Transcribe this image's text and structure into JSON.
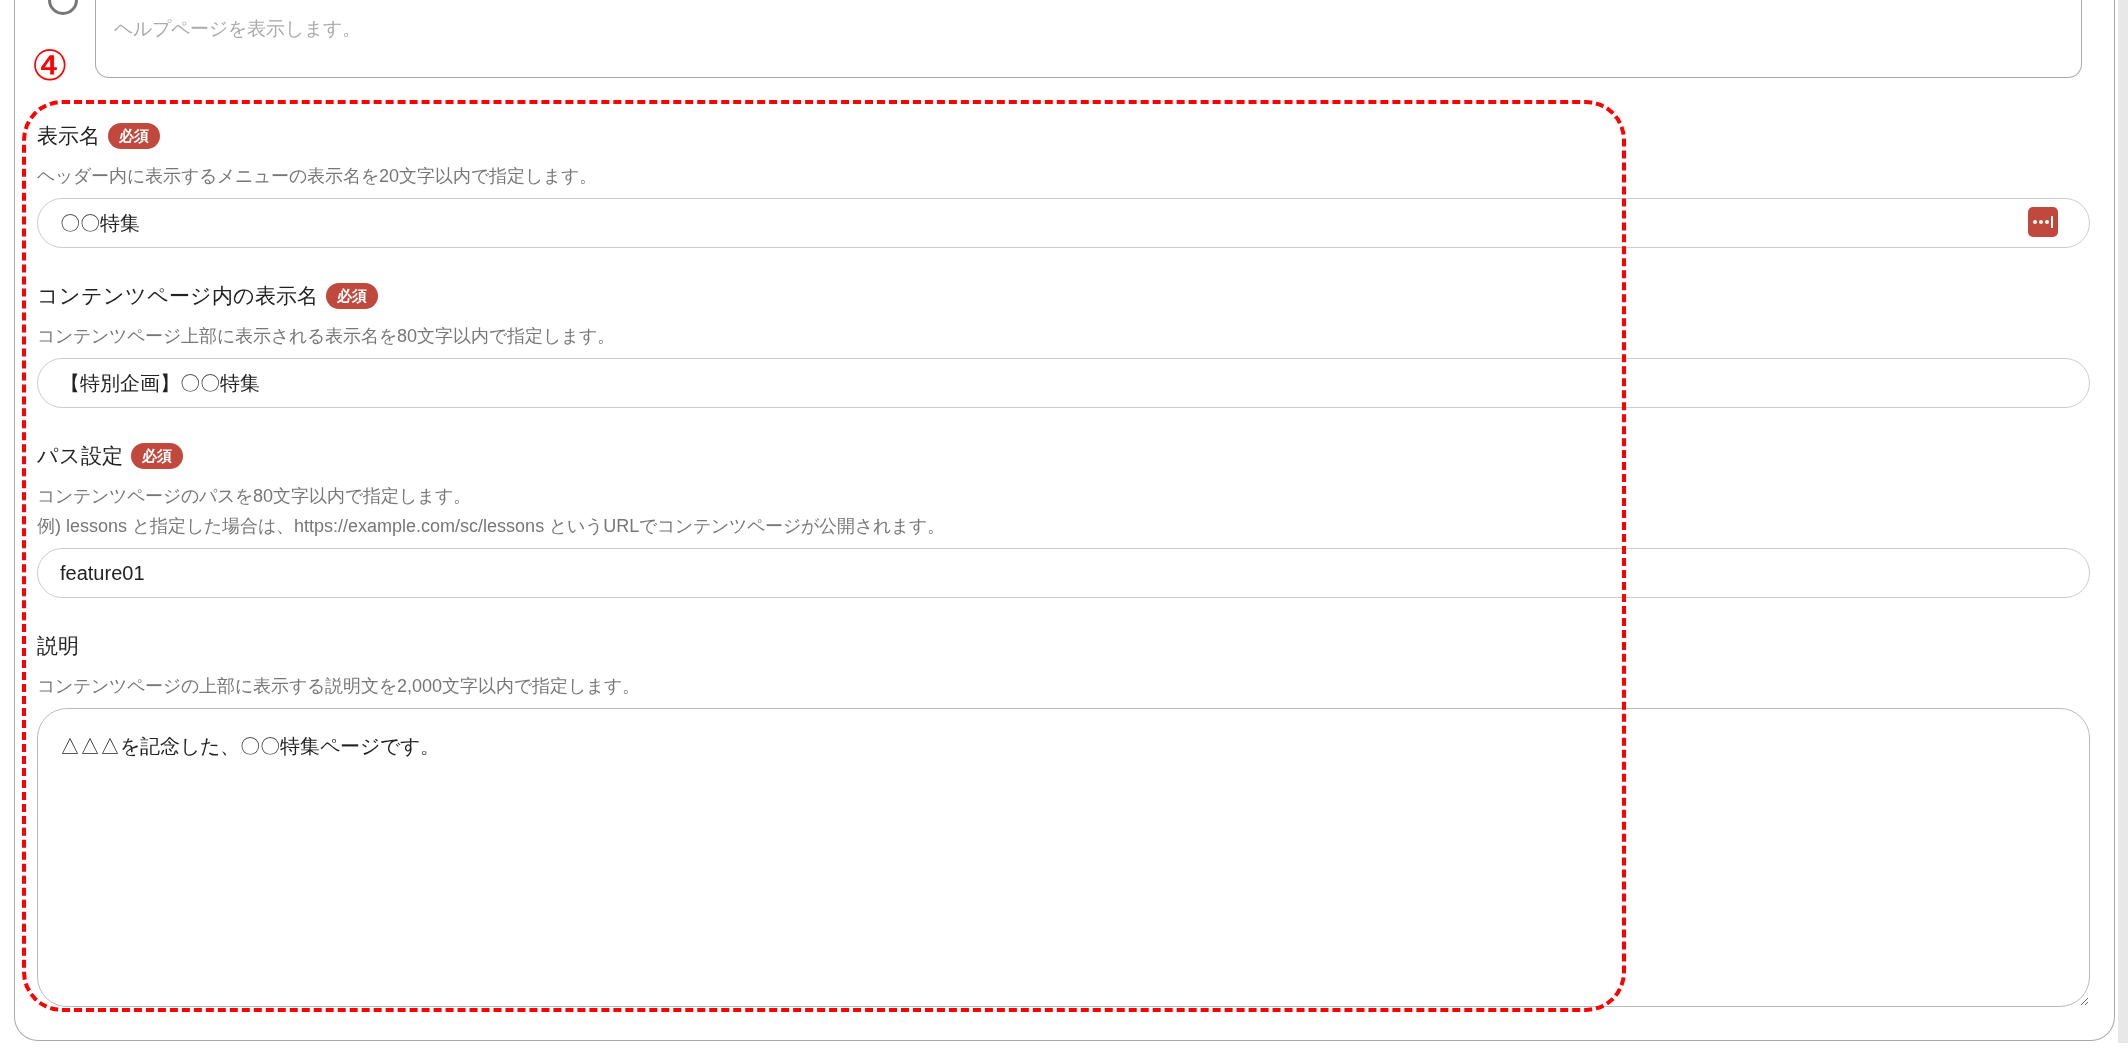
{
  "help_option": {
    "selected": false,
    "placeholder": "ヘルプページを表示します。"
  },
  "annotation": {
    "label": "④"
  },
  "fields": [
    {
      "kind": "input",
      "label": "表示名",
      "required_badge": "必須",
      "descriptions": [
        "ヘッダー内に表示するメニューの表示名を20文字以内で指定します。"
      ],
      "value": "〇〇特集",
      "menu_button": true
    },
    {
      "kind": "input",
      "label": "コンテンツページ内の表示名",
      "required_badge": "必須",
      "descriptions": [
        "コンテンツページ上部に表示される表示名を80文字以内で指定します。"
      ],
      "value": "【特別企画】〇〇特集",
      "menu_button": false
    },
    {
      "kind": "input",
      "label": "パス設定",
      "required_badge": "必須",
      "descriptions": [
        "コンテンツページのパスを80文字以内で指定します。",
        "例) lessons と指定した場合は、https://example.com/sc/lessons というURLでコンテンツページが公開されます。"
      ],
      "value": "feature01",
      "menu_button": false
    },
    {
      "kind": "textarea",
      "label": "説明",
      "descriptions": [
        "コンテンツページの上部に表示する説明文を2,000文字以内で指定します。"
      ],
      "value": "△△△を記念した、〇〇特集ページです。",
      "menu_button": false
    }
  ]
}
